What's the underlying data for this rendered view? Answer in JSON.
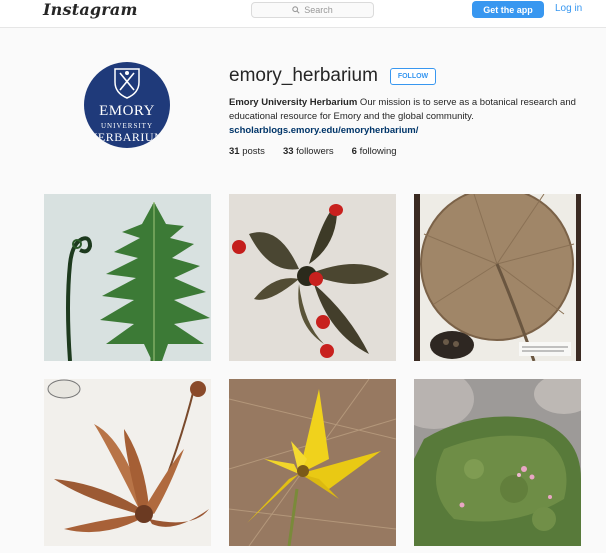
{
  "header": {
    "brand": "Instagram",
    "search_placeholder": "Search",
    "get_app_label": "Get the app",
    "login_label": "Log in"
  },
  "avatar": {
    "line1": "EMORY",
    "line2": "UNIVERSITY",
    "line3": "HERBARIUM"
  },
  "profile": {
    "username": "emory_herbarium",
    "follow_label": "FOLLOW",
    "full_name": "Emory University Herbarium",
    "bio": " Our mission is to serve as a botanical research and educational resource for Emory and the global community.",
    "website": "scholarblogs.emory.edu/emoryherbarium/"
  },
  "stats": {
    "posts_count": "31",
    "posts_label": " posts",
    "followers_count": "33",
    "followers_label": " followers",
    "following_count": "6",
    "following_label": " following"
  },
  "posts": [
    {
      "icon": "fern-frond-photo"
    },
    {
      "icon": "seed-pod-red-seeds-photo"
    },
    {
      "icon": "lotus-leaf-specimen-photo"
    },
    {
      "icon": "pitcher-plant-specimen-photo"
    },
    {
      "icon": "yellow-trout-lily-photo"
    },
    {
      "icon": "moss-on-rock-photo"
    }
  ],
  "colors": {
    "accent": "#3897f0",
    "avatar_bg": "#1f3a7a",
    "link": "#003569"
  }
}
